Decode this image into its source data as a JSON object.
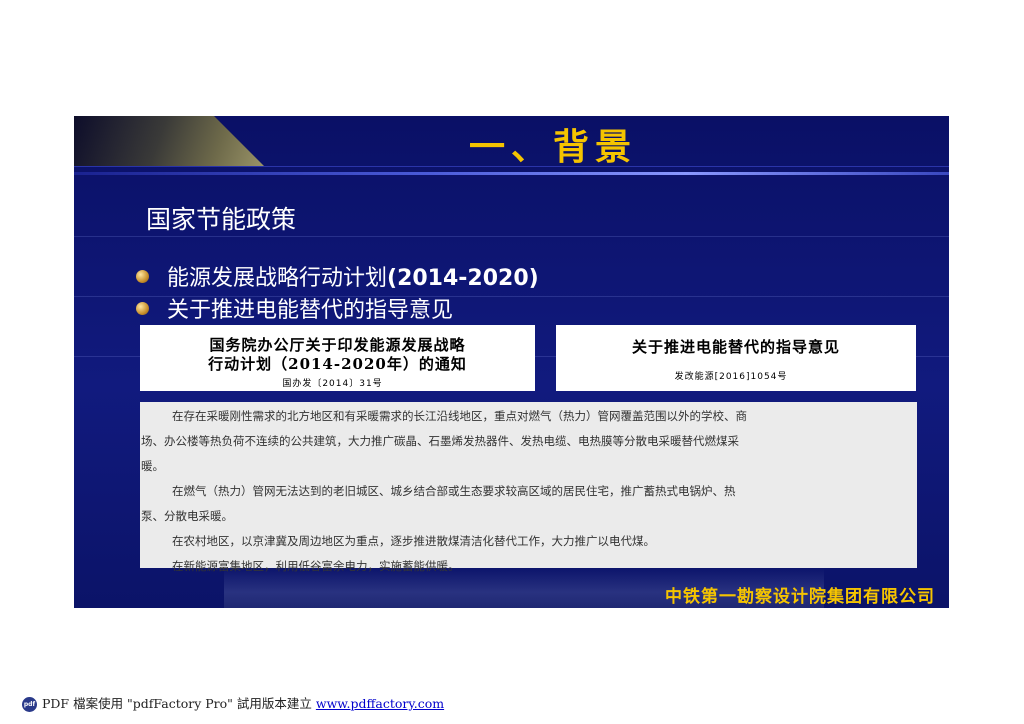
{
  "slide": {
    "title": "一、背景",
    "heading": "国家节能政策",
    "bullets": [
      {
        "text": "能源发展战略行动计划",
        "bold_suffix": "(2014-2020)"
      },
      {
        "text": "关于推进电能替代的指导意见",
        "bold_suffix": ""
      }
    ],
    "doc_left": {
      "title_line1": "国务院办公厅关于印发能源发展战略",
      "title_line2": "行动计划（2014-2020年）的通知",
      "number": "国办发〔2014〕31号"
    },
    "doc_right": {
      "title": "关于推进电能替代的指导意见",
      "number": "发改能源[2016]1054号"
    },
    "text_lines": [
      "在存在采暖刚性需求的北方地区和有采暖需求的长江沿线地区，重点对燃气（热力）管网覆盖范围以外的学校、商",
      "场、办公楼等热负荷不连续的公共建筑，大力推广碳晶、石墨烯发热器件、发热电缆、电热膜等分散电采暖替代燃煤采",
      "暖。",
      "在燃气（热力）管网无法达到的老旧城区、城乡结合部或生态要求较高区域的居民住宅，推广蓄热式电锅炉、热",
      "泵、分散电采暖。",
      "在农村地区，以京津冀及周边地区为重点，逐步推进散煤清洁化替代工作，大力推广以电代煤。",
      "在新能源富集地区，利用低谷富余电力，实施蓄能供暖。"
    ],
    "footer": "中铁第一勘察设计院集团有限公司"
  },
  "pdf_footer": {
    "icon": "pdf",
    "text": "PDF 檔案使用 \"pdfFactory Pro\" 試用版本建立 ",
    "link": "www.pdffactory.com"
  }
}
